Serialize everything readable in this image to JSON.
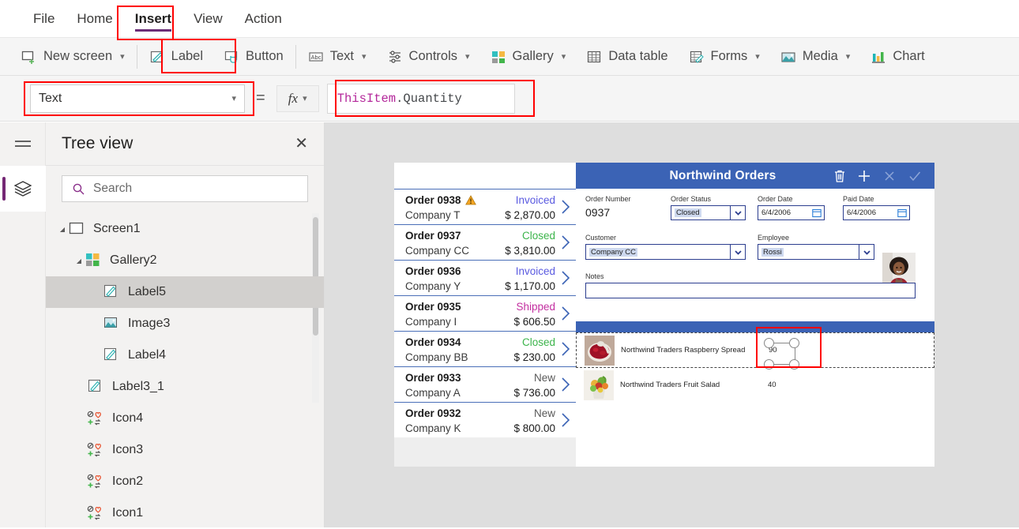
{
  "menu": {
    "tabs": [
      {
        "label": "File",
        "active": false
      },
      {
        "label": "Home",
        "active": false
      },
      {
        "label": "Insert",
        "active": true
      },
      {
        "label": "View",
        "active": false
      },
      {
        "label": "Action",
        "active": false
      }
    ]
  },
  "ribbon": {
    "items": [
      {
        "label": "New screen",
        "icon": "new-screen-icon",
        "caret": true
      },
      {
        "label": "Label",
        "icon": "label-icon",
        "caret": false
      },
      {
        "label": "Button",
        "icon": "button-icon",
        "caret": false
      },
      {
        "label": "Text",
        "icon": "text-icon",
        "caret": true
      },
      {
        "label": "Controls",
        "icon": "controls-icon",
        "caret": true
      },
      {
        "label": "Gallery",
        "icon": "gallery-icon",
        "caret": true
      },
      {
        "label": "Data table",
        "icon": "data-table-icon",
        "caret": false
      },
      {
        "label": "Forms",
        "icon": "forms-icon",
        "caret": true
      },
      {
        "label": "Media",
        "icon": "media-icon",
        "caret": true
      },
      {
        "label": "Chart",
        "icon": "chart-icon",
        "caret": false
      }
    ]
  },
  "formula_bar": {
    "property": "Text",
    "equals": "=",
    "fx_label": "fx",
    "formula_object": "ThisItem",
    "formula_property": ".Quantity"
  },
  "tree_view": {
    "title": "Tree view",
    "close_label": "✕",
    "search_placeholder": "Search",
    "items": [
      {
        "label": "Screen1",
        "icon": "screen-icon",
        "indent": 0,
        "twisty": "◢",
        "selected": false
      },
      {
        "label": "Gallery2",
        "icon": "gallery-icon",
        "indent": 1,
        "twisty": "◢",
        "selected": false
      },
      {
        "label": "Label5",
        "icon": "label-icon",
        "indent": 2,
        "twisty": "",
        "selected": true
      },
      {
        "label": "Image3",
        "icon": "image-icon",
        "indent": 2,
        "twisty": "",
        "selected": false
      },
      {
        "label": "Label4",
        "icon": "label-icon",
        "indent": 2,
        "twisty": "",
        "selected": false
      },
      {
        "label": "Label3_1",
        "icon": "label-icon",
        "indent": 1,
        "twisty": "",
        "selected": false
      },
      {
        "label": "Icon4",
        "icon": "icons-icon",
        "indent": 1,
        "twisty": "",
        "selected": false
      },
      {
        "label": "Icon3",
        "icon": "icons-icon",
        "indent": 1,
        "twisty": "",
        "selected": false
      },
      {
        "label": "Icon2",
        "icon": "icons-icon",
        "indent": 1,
        "twisty": "",
        "selected": false
      },
      {
        "label": "Icon1",
        "icon": "icons-icon",
        "indent": 1,
        "twisty": "",
        "selected": false
      }
    ]
  },
  "app": {
    "title": "Northwind Orders",
    "topbar_icons": [
      "delete-icon",
      "add-icon",
      "cancel-icon",
      "save-icon"
    ],
    "orders": [
      {
        "order": "Order 0938",
        "company": "Company T",
        "status": "Invoiced",
        "status_color": "#5a5ae0",
        "amount": "$ 2,870.00",
        "warning": true
      },
      {
        "order": "Order 0937",
        "company": "Company CC",
        "status": "Closed",
        "status_color": "#3cb44b",
        "amount": "$ 3,810.00",
        "warning": false
      },
      {
        "order": "Order 0936",
        "company": "Company Y",
        "status": "Invoiced",
        "status_color": "#5a5ae0",
        "amount": "$ 1,170.00",
        "warning": false
      },
      {
        "order": "Order 0935",
        "company": "Company I",
        "status": "Shipped",
        "status_color": "#c32fa0",
        "amount": "$ 606.50",
        "warning": false
      },
      {
        "order": "Order 0934",
        "company": "Company BB",
        "status": "Closed",
        "status_color": "#3cb44b",
        "amount": "$ 230.00",
        "warning": false
      },
      {
        "order": "Order 0933",
        "company": "Company A",
        "status": "New",
        "status_color": "#595959",
        "amount": "$ 736.00",
        "warning": false
      },
      {
        "order": "Order 0932",
        "company": "Company K",
        "status": "New",
        "status_color": "#595959",
        "amount": "$ 800.00",
        "warning": false
      }
    ],
    "form": {
      "order_number_label": "Order Number",
      "order_number_value": "0937",
      "order_status_label": "Order Status",
      "order_status_value": "Closed",
      "order_date_label": "Order Date",
      "order_date_value": "6/4/2006",
      "paid_date_label": "Paid Date",
      "paid_date_value": "6/4/2006",
      "customer_label": "Customer",
      "customer_value": "Company CC",
      "employee_label": "Employee",
      "employee_value": "Rossi",
      "notes_label": "Notes",
      "notes_value": ""
    },
    "order_details": [
      {
        "product": "Northwind Traders Raspberry Spread",
        "quantity": "90",
        "selected": true,
        "thumb": "raspberry-spread-thumbnail"
      },
      {
        "product": "Northwind Traders Fruit Salad",
        "quantity": "40",
        "selected": false,
        "thumb": "fruit-salad-thumbnail"
      }
    ]
  },
  "colors": {
    "accent_purple": "#6b2d77",
    "app_blue": "#3b63b5",
    "annotation_red": "#ff0000",
    "canvas_gray": "#dedede"
  }
}
